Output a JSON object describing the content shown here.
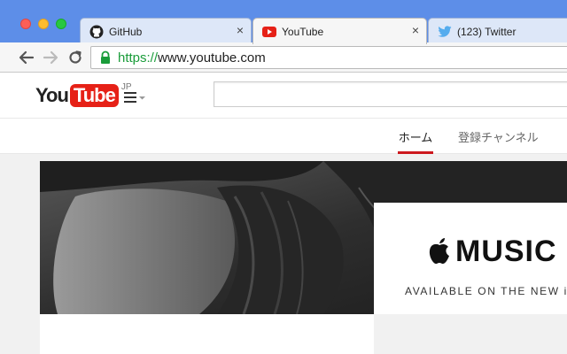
{
  "browser": {
    "tabs": [
      {
        "title": "GitHub",
        "favicon": "github-icon",
        "active": false
      },
      {
        "title": "YouTube",
        "favicon": "youtube-icon",
        "active": true
      },
      {
        "title": "(123) Twitter",
        "favicon": "twitter-icon",
        "active": false
      }
    ],
    "close_glyph": "×",
    "url_scheme": "https://",
    "url_rest": "www.youtube.com",
    "colors": {
      "tabstrip": "#5d8ee8",
      "secure": "#1a9c3a"
    }
  },
  "youtube": {
    "logo_you": "You",
    "logo_tube": "Tube",
    "logo_region": "JP",
    "search_placeholder": "",
    "feed_tabs": [
      {
        "label": "ホーム",
        "active": true
      },
      {
        "label": "登録チャンネル",
        "active": false
      }
    ],
    "colors": {
      "brand_red": "#e62117",
      "tab_underline": "#cc181e"
    }
  },
  "banner": {
    "brand": "MUSIC",
    "tagline": "AVAILABLE ON THE NEW i"
  }
}
